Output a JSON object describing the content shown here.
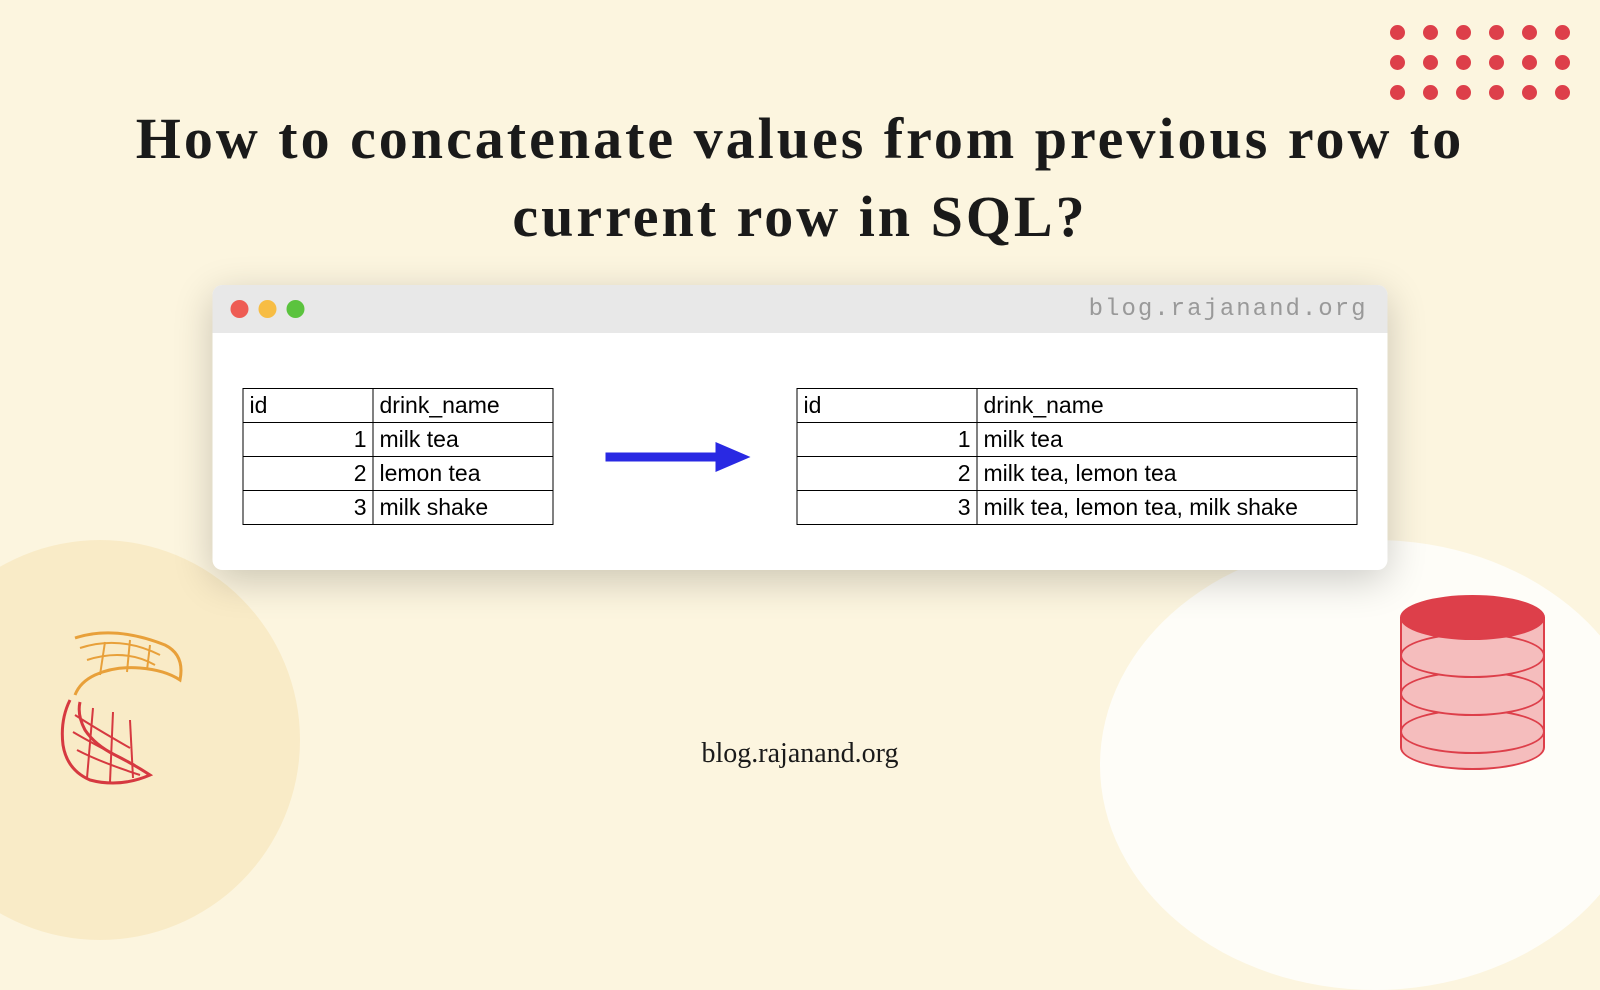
{
  "title": "How to concatenate values from previous row to current row in SQL?",
  "window": {
    "url_text": "blog.rajanand.org"
  },
  "footer": "blog.rajanand.org",
  "table_left": {
    "headers": {
      "id": "id",
      "name": "drink_name"
    },
    "rows": [
      {
        "id": "1",
        "name": "milk tea"
      },
      {
        "id": "2",
        "name": "lemon tea"
      },
      {
        "id": "3",
        "name": "milk shake"
      }
    ]
  },
  "table_right": {
    "headers": {
      "id": "id",
      "name": "drink_name"
    },
    "rows": [
      {
        "id": "1",
        "name": "milk tea"
      },
      {
        "id": "2",
        "name": "milk tea, lemon tea"
      },
      {
        "id": "3",
        "name": "milk tea, lemon tea, milk shake"
      }
    ]
  },
  "colors": {
    "accent_red": "#dd3f4a",
    "arrow_blue": "#2929e3",
    "bg_cream": "#fcf5df"
  }
}
